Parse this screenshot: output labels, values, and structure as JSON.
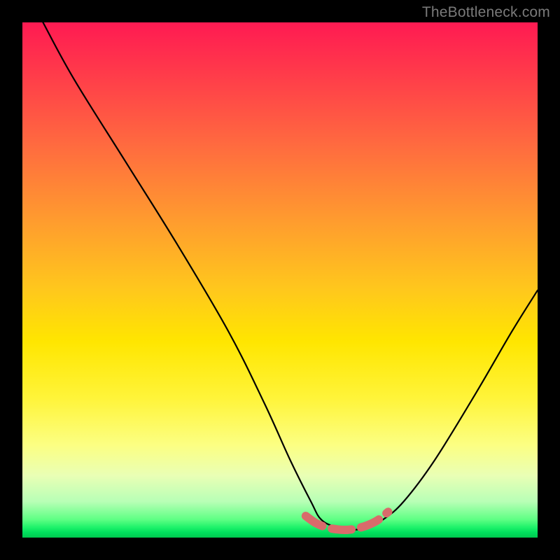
{
  "attribution": "TheBottleneck.com",
  "chart_data": {
    "type": "line",
    "title": "",
    "xlabel": "",
    "ylabel": "",
    "xlim": [
      0,
      100
    ],
    "ylim": [
      0,
      100
    ],
    "grid": false,
    "series": [
      {
        "name": "bottleneck-curve",
        "x": [
          4,
          10,
          20,
          30,
          40,
          47,
          52,
          56,
          58,
          61,
          64,
          67,
          70,
          74,
          80,
          88,
          95,
          100
        ],
        "values": [
          100,
          89,
          73,
          57,
          40,
          26,
          15,
          7,
          3.5,
          2,
          1.5,
          2,
          3.5,
          7,
          15,
          28,
          40,
          48
        ]
      },
      {
        "name": "highlight-segment",
        "x": [
          55,
          57,
          59,
          61,
          63,
          65,
          67,
          69,
          71
        ],
        "values": [
          4.2,
          2.8,
          2,
          1.6,
          1.5,
          1.8,
          2.4,
          3.4,
          5
        ]
      }
    ],
    "gradient_stops": [
      {
        "pos": 0,
        "color": "#ff1a52"
      },
      {
        "pos": 24,
        "color": "#ff6b3f"
      },
      {
        "pos": 52,
        "color": "#ffc81c"
      },
      {
        "pos": 82,
        "color": "#fcff82"
      },
      {
        "pos": 96,
        "color": "#5eff84"
      },
      {
        "pos": 100,
        "color": "#00c84f"
      }
    ]
  }
}
